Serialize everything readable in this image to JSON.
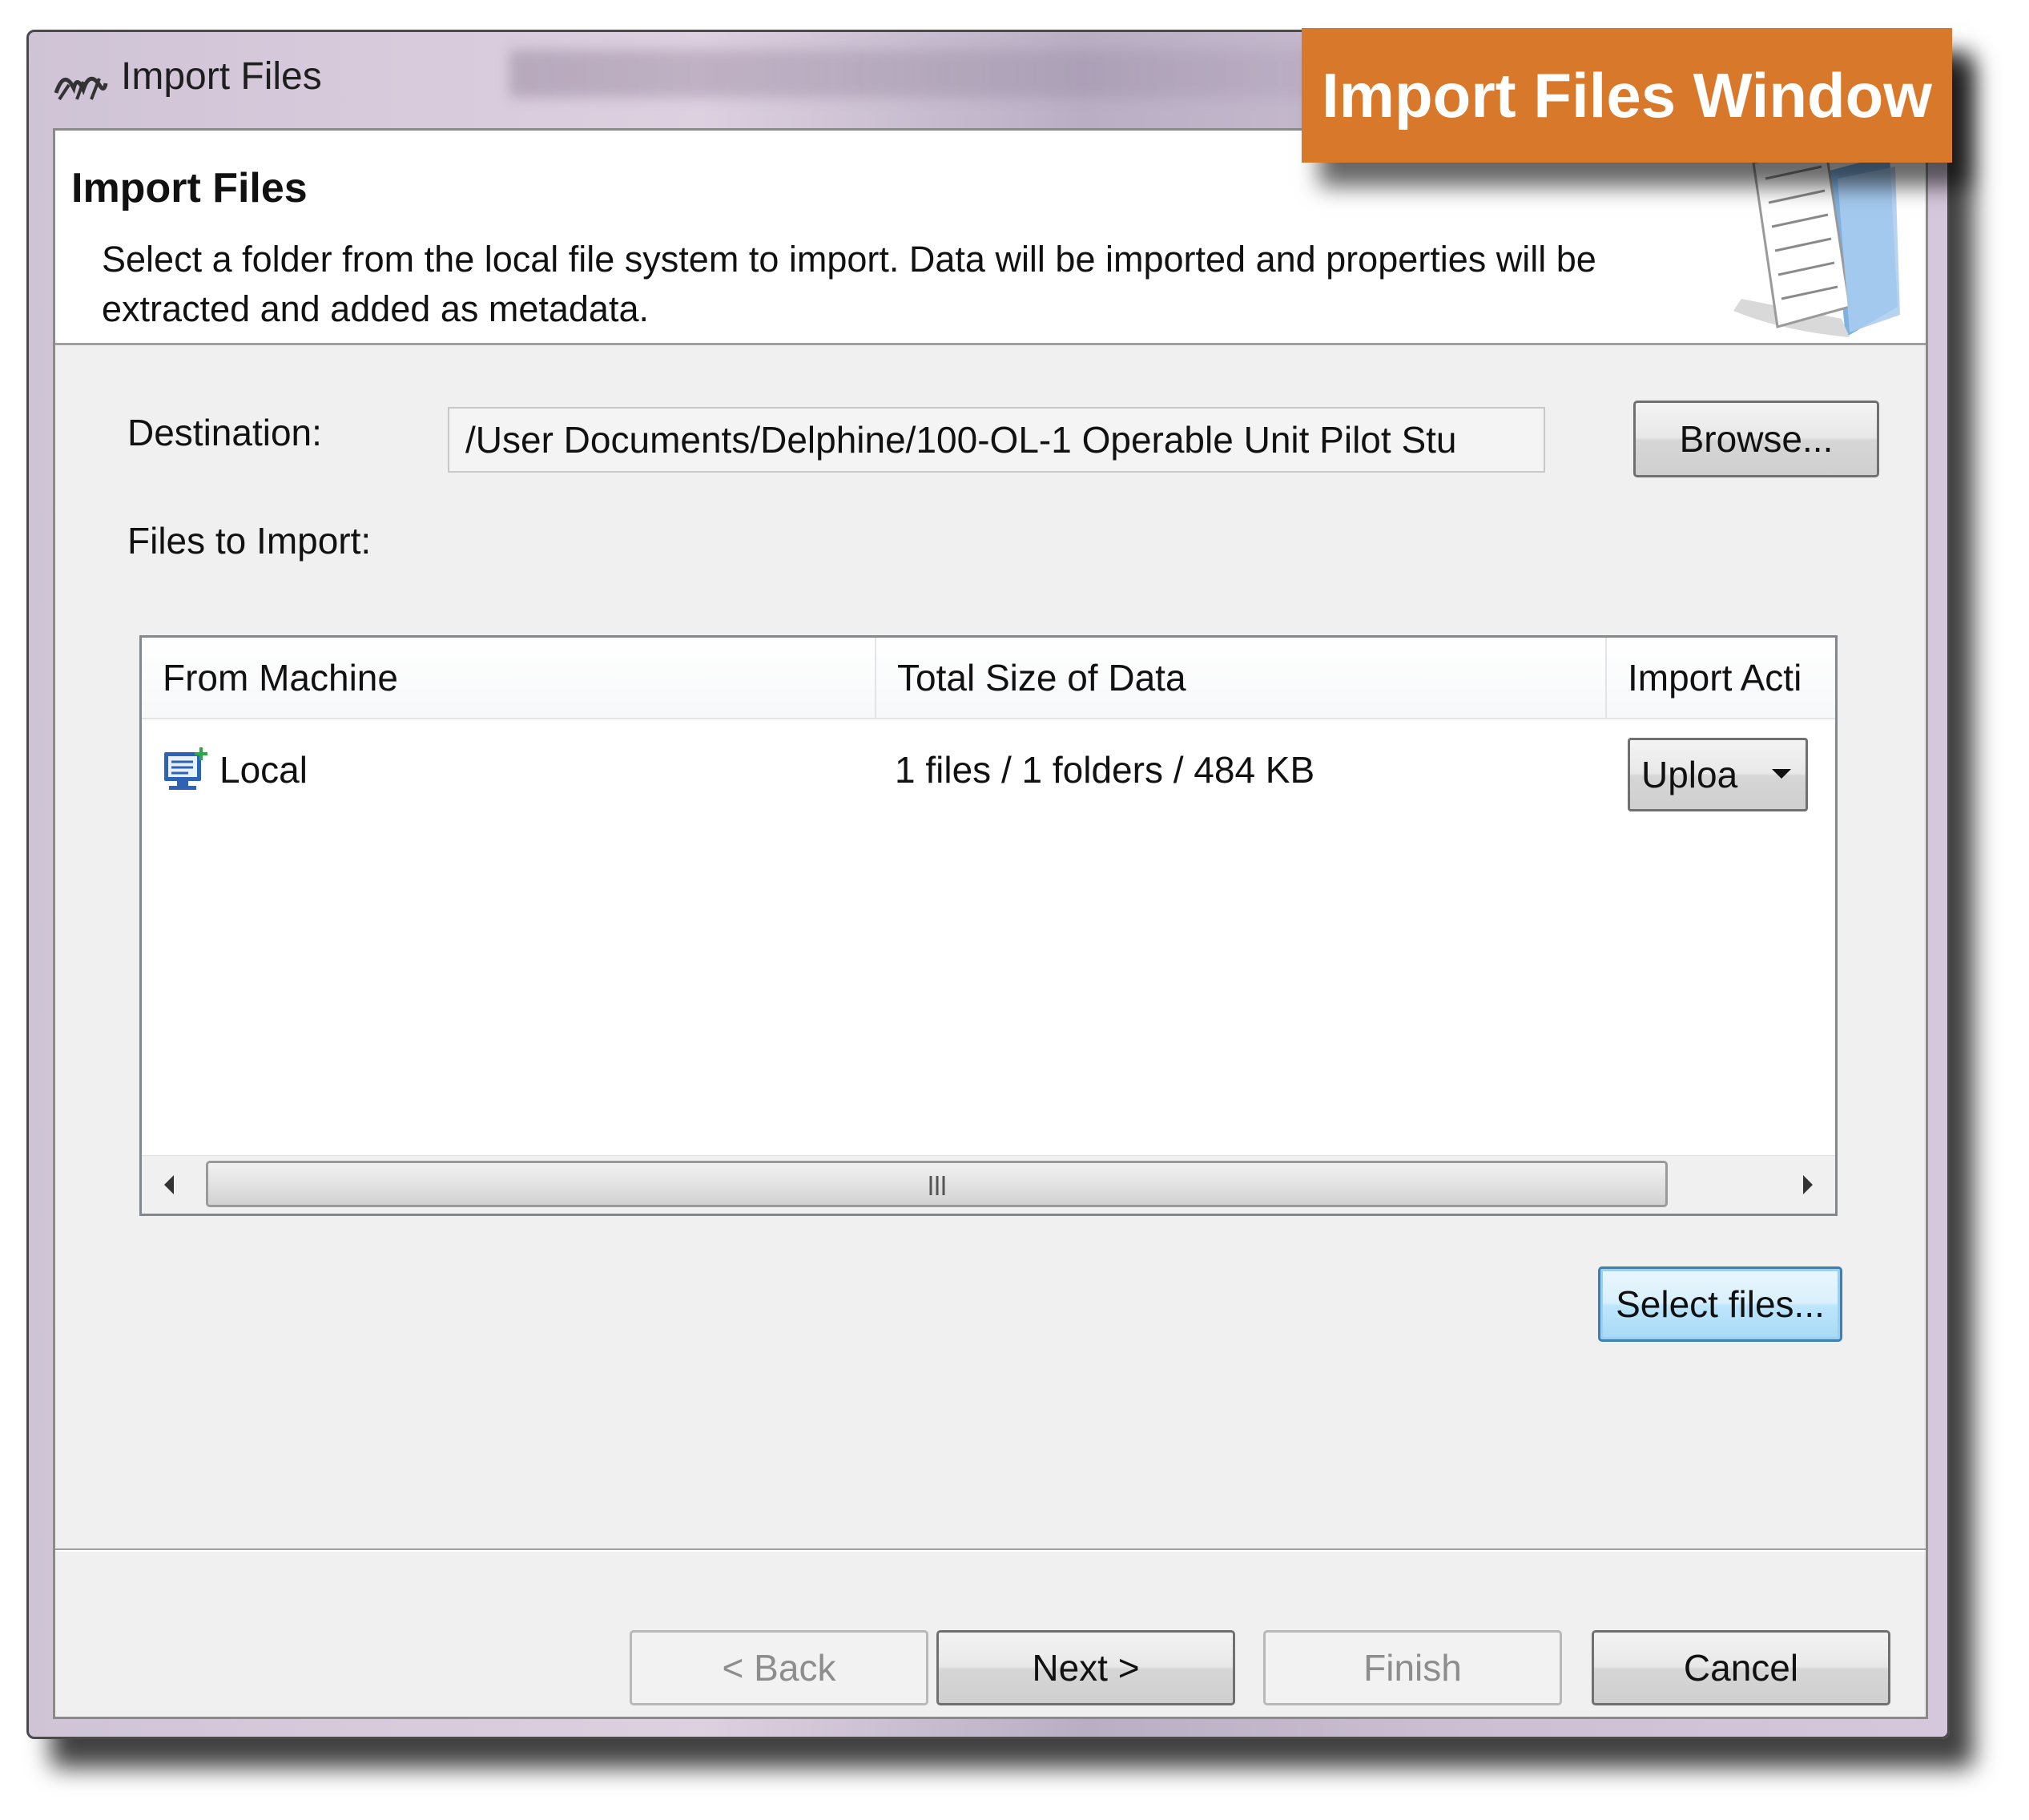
{
  "window": {
    "title": "Import Files"
  },
  "callout": {
    "label": "Import Files Window"
  },
  "header": {
    "title": "Import Files",
    "description": "Select a folder from the local file system to import. Data will be imported and properties will be extracted and added as metadata."
  },
  "destination": {
    "label": "Destination:",
    "value": "/User Documents/Delphine/100-OL-1 Operable Unit Pilot Stu",
    "browse_label": "Browse..."
  },
  "files": {
    "label": "Files to Import:",
    "columns": [
      "From Machine",
      "Total Size of Data",
      "Import Acti"
    ],
    "rows": [
      {
        "machine": "Local",
        "size": "1 files / 1 folders / 484 KB",
        "action": "Uploa"
      }
    ],
    "select_files_label": "Select files..."
  },
  "footer": {
    "back_label": "< Back",
    "next_label": "Next >",
    "finish_label": "Finish",
    "cancel_label": "Cancel"
  },
  "colors": {
    "callout_bg": "#d8782b",
    "dialog_bg": "#f0f0f0",
    "focus_border": "#3c7fb1"
  },
  "icons": {
    "app": "app-logo-icon",
    "header_graphic": "document-folder-icon",
    "machine": "computer-monitor-icon"
  }
}
